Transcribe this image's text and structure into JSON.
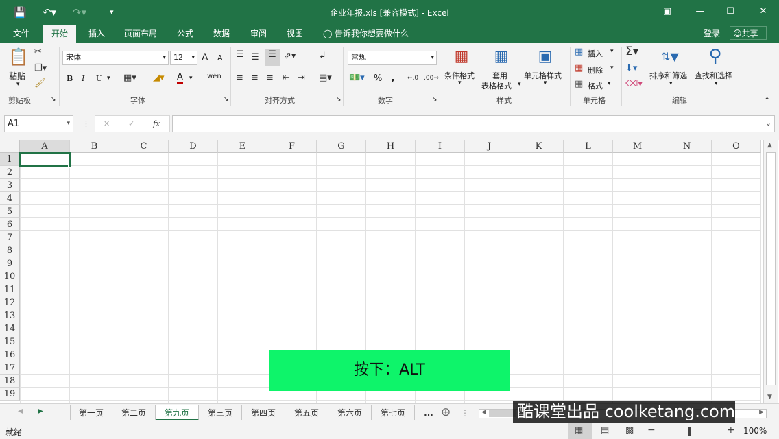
{
  "window": {
    "title": "企业年报.xls  [兼容模式] - Excel"
  },
  "quick_access": {
    "save_icon": "save-icon",
    "undo_icon": "undo-icon",
    "redo_icon": "redo-icon",
    "customize_icon": "customize-icon"
  },
  "tabs": [
    "文件",
    "开始",
    "插入",
    "页面布局",
    "公式",
    "数据",
    "审阅",
    "视图"
  ],
  "active_tab": "开始",
  "tell_me": "告诉我你想要做什么",
  "signin": "登录",
  "share": "共享",
  "ribbon": {
    "clipboard": {
      "paste": "粘贴",
      "label": "剪贴板"
    },
    "font": {
      "name": "宋体",
      "size": "12",
      "bold": "B",
      "italic": "I",
      "underline": "U",
      "grow": "A",
      "shrink": "A",
      "font_color": "A",
      "phonetic": "wén",
      "label": "字体"
    },
    "alignment": {
      "label": "对齐方式"
    },
    "number": {
      "format": "常规",
      "percent": "%",
      "comma": ",",
      "label": "数字"
    },
    "styles": {
      "conditional": "条件格式",
      "table_format_1": "套用",
      "table_format_2": "表格格式",
      "cell_styles": "单元格样式",
      "label": "样式"
    },
    "cells": {
      "insert": "插入",
      "delete": "删除",
      "format": "格式",
      "label": "单元格"
    },
    "editing": {
      "sort_filter": "排序和筛选",
      "find_select": "查找和选择",
      "label": "编辑"
    }
  },
  "formula_bar": {
    "name_box": "A1",
    "cancel": "✕",
    "enter": "✓",
    "fx": "fx",
    "value": ""
  },
  "columns": [
    "A",
    "B",
    "C",
    "D",
    "E",
    "F",
    "G",
    "H",
    "I",
    "J",
    "K",
    "L",
    "M",
    "N",
    "O"
  ],
  "rows": [
    "1",
    "2",
    "3",
    "4",
    "5",
    "6",
    "7",
    "8",
    "9",
    "10",
    "11",
    "12",
    "13",
    "14",
    "15",
    "16",
    "17",
    "18",
    "19"
  ],
  "sheets": [
    "第一页",
    "第二页",
    "第九页",
    "第三页",
    "第四页",
    "第五页",
    "第六页",
    "第七页"
  ],
  "active_sheet": "第九页",
  "sheet_more": "...",
  "status": {
    "ready": "就绪",
    "zoom": "100%"
  },
  "overlay_text": "按下：ALT",
  "watermark": "酷课堂出品 coolketang.com",
  "colors": {
    "accent": "#217346",
    "overlay": "#0ef46a"
  }
}
